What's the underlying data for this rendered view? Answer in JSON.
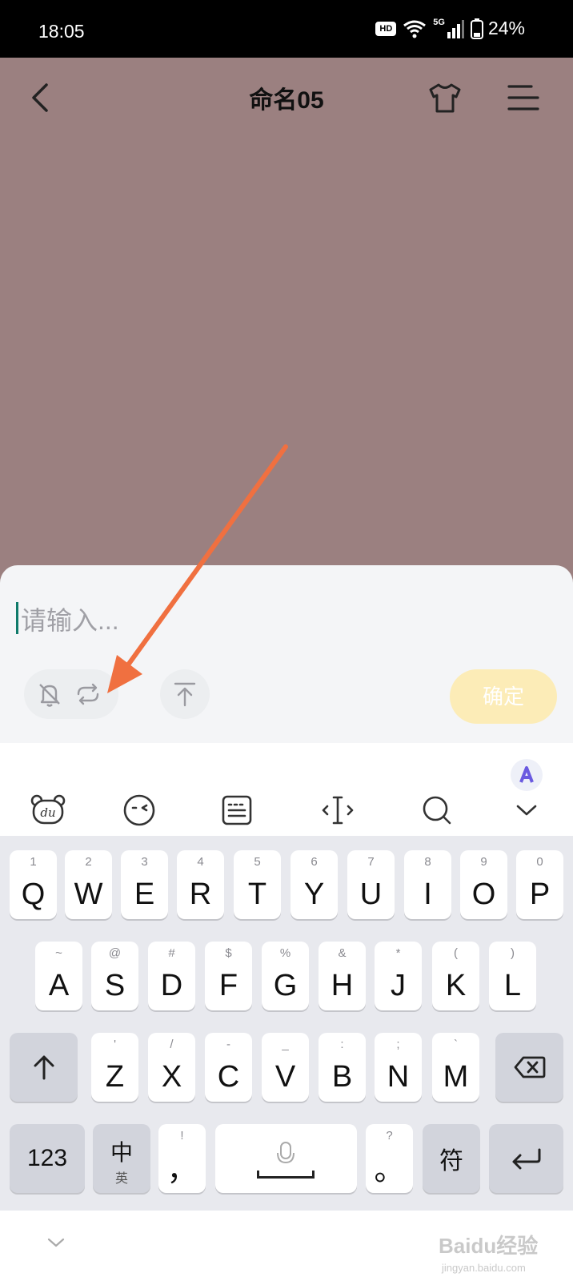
{
  "status_bar": {
    "time": "18:05",
    "hd": "HD",
    "network": "5G",
    "battery": "24%"
  },
  "header": {
    "title": "命名05"
  },
  "input": {
    "placeholder": "请输入..."
  },
  "confirm_label": "确定",
  "keyboard": {
    "row1": [
      [
        "1",
        "Q"
      ],
      [
        "2",
        "W"
      ],
      [
        "3",
        "E"
      ],
      [
        "4",
        "R"
      ],
      [
        "5",
        "T"
      ],
      [
        "6",
        "Y"
      ],
      [
        "7",
        "U"
      ],
      [
        "8",
        "I"
      ],
      [
        "9",
        "O"
      ],
      [
        "0",
        "P"
      ]
    ],
    "row2": [
      [
        "~",
        "A"
      ],
      [
        "@",
        "S"
      ],
      [
        "#",
        "D"
      ],
      [
        "$",
        "F"
      ],
      [
        "%",
        "G"
      ],
      [
        "&",
        "H"
      ],
      [
        "*",
        "J"
      ],
      [
        "(",
        "K"
      ],
      [
        ")",
        "L"
      ]
    ],
    "row3": [
      [
        "'",
        "Z"
      ],
      [
        "/",
        "X"
      ],
      [
        "-",
        "C"
      ],
      [
        "_",
        "V"
      ],
      [
        ":",
        "B"
      ],
      [
        ";",
        "N"
      ],
      [
        "`",
        "M"
      ]
    ],
    "num_label": "123",
    "lang_main": "中",
    "lang_sub": "英",
    "comma_sub": "!",
    "comma_main": "，",
    "period_sub": "?",
    "period_main": "。",
    "symbols_label": "符"
  },
  "watermark": {
    "main": "Baidu经验",
    "sub": "jingyan.baidu.com"
  },
  "colors": {
    "accent_arrow": "#f07040",
    "confirm_bg": "#fcecb7",
    "canvas_bg": "#9b8080",
    "cursor": "#0f7a6a"
  }
}
